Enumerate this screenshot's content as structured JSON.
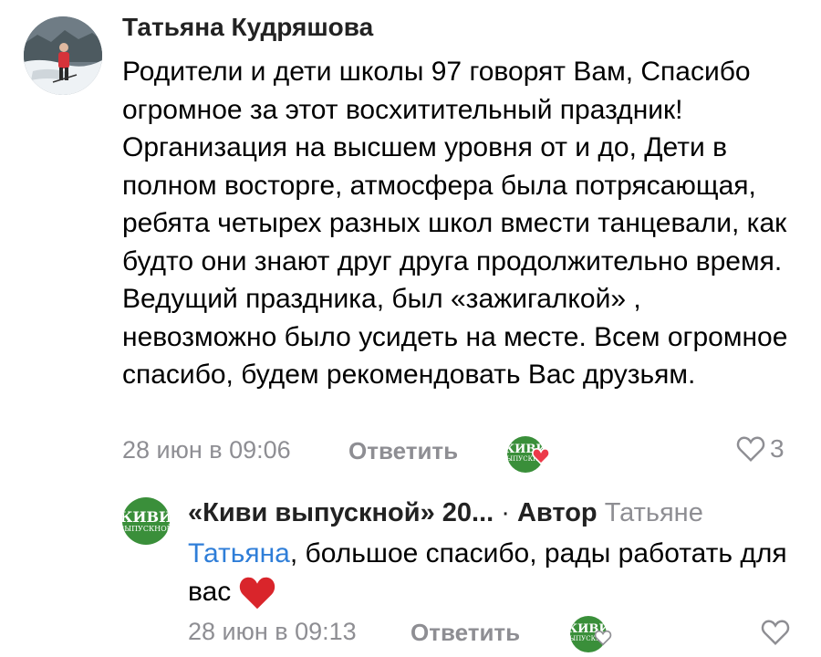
{
  "comment": {
    "author": "Татьяна Кудряшова",
    "text": "Родители и дети школы 97 говорят Вам, Спасибо огромное за этот восхитительный праздник! Организация на высшем уровня от и до, Дети в полном восторге, атмосфера была потрясающая, ребята четырех разных школ вмести танцевали, как будто они знают друг друга продолжительно время. Ведущий праздника, был «зажигалкой» , невозможно было усидеть на месте. Всем огромное спасибо, будем рекомендовать Вас друзьям.",
    "timestamp": "28 июн в 09:06",
    "reply_label": "Ответить",
    "like_count": "3",
    "reaction_icon": "kiwi-logo-with-heart"
  },
  "reply": {
    "author": "«Киви выпускной» 20...",
    "separator": " · ",
    "role": "Автор",
    "reply_to": "Татьяне",
    "mention": "Татьяна",
    "text": ", большое спасибо, рады работать для вас",
    "emoji": "heart",
    "timestamp": "28 июн в 09:13",
    "reply_label": "Ответить"
  },
  "logo": {
    "line1": "КИВИ",
    "line2": "ВЫПУСКНОЙ"
  },
  "colors": {
    "meta_gray": "#8e8e93",
    "link_blue": "#2f7ed8",
    "kiwi_green": "#3a8f3a",
    "heart_red": "#d9252b"
  }
}
